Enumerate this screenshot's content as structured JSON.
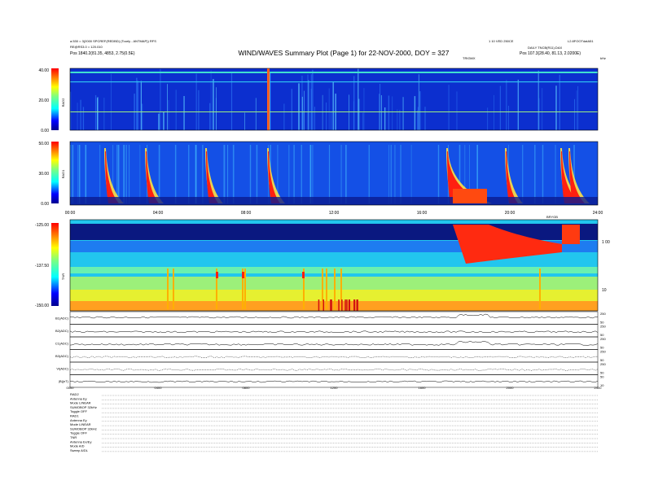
{
  "header": {
    "title": "WIND/WAVES Summary Plot (Page 1) for 22-NOV-2000, DOY = 327",
    "left_line1": "a.530 = 3(2000 SPCREF(REDBD) (Toorly - ANTMAP)) RFS",
    "left_line2": "RE@RS3.0 = 120.010",
    "left_line3": "Pos   1840.2(81.35, 4853, 2.75(0.5E)",
    "right_top1": "1 10 VED 250CE",
    "right_top2": "L2.8FOOTdatA51",
    "right_line1": "DAILY TNCB(R11).DAX",
    "right_line2": "Pos   107.3(28.40, 81.13, 2.0200E)",
    "right_tag": "TRIGMX",
    "right_unit": "kHz"
  },
  "chart_data": [
    {
      "type": "heatmap",
      "name": "RAD2",
      "ylabel": "RAD2",
      "yticks": [
        "40.00",
        "20.00",
        "0.00"
      ],
      "ylim": [
        0,
        40
      ],
      "colormap": "jet"
    },
    {
      "type": "heatmap",
      "name": "RAD1",
      "ylabel": "RAD1",
      "yticks": [
        "50.00",
        "30.00",
        "0.00"
      ],
      "ylim": [
        0,
        50
      ],
      "colormap": "jet"
    },
    {
      "type": "heatmap",
      "name": "TNR",
      "ylabel": "TNR",
      "yticks": [
        "-125.00",
        "-137.50",
        "-150.00"
      ],
      "ylim": [
        -150,
        -125
      ],
      "right_ticks": [
        "1 00",
        "10"
      ],
      "corner_label": "BRYGB",
      "colormap": "jet"
    },
    {
      "type": "line",
      "stack": [
        {
          "label": "B1(ADC)",
          "right_ticks": [
            "250",
            "50"
          ]
        },
        {
          "label": "B2(ADC)",
          "right_ticks": [
            "250",
            "50"
          ]
        },
        {
          "label": "C1(ADC)",
          "right_ticks": [
            "250",
            "50"
          ]
        },
        {
          "label": "B3(ADC)",
          "right_ticks": [
            "250",
            "50"
          ]
        },
        {
          "label": "Vi(ADC)",
          "right_ticks": [
            "250",
            "50"
          ]
        },
        {
          "label": "|B|(nT)",
          "right_ticks": [
            "50",
            "10"
          ]
        }
      ]
    }
  ],
  "xaxis": {
    "ticks": [
      "00:00",
      "04:00",
      "08:00",
      "12:00",
      "16:00",
      "20:00",
      "24:00"
    ],
    "ticks_bottom": [
      "0000",
      "0400",
      "0800",
      "1200",
      "1600",
      "2000",
      "2400"
    ],
    "xlim": [
      0,
      24
    ]
  },
  "footer": {
    "lines": [
      "RAD2",
      "Antenna  Ey",
      "Mode   LINEAR",
      "SUMOBOP  32kHz",
      "Toggle   OFF",
      "RAD1",
      "Antenna  Ey",
      "Mode   LINEAR",
      "SUMOBOP  32kHz",
      "Toggle   OFF",
      "TNR",
      "Antenna  Ex/Ey",
      "Mode   A/D",
      "Sweep   A/DL"
    ]
  }
}
